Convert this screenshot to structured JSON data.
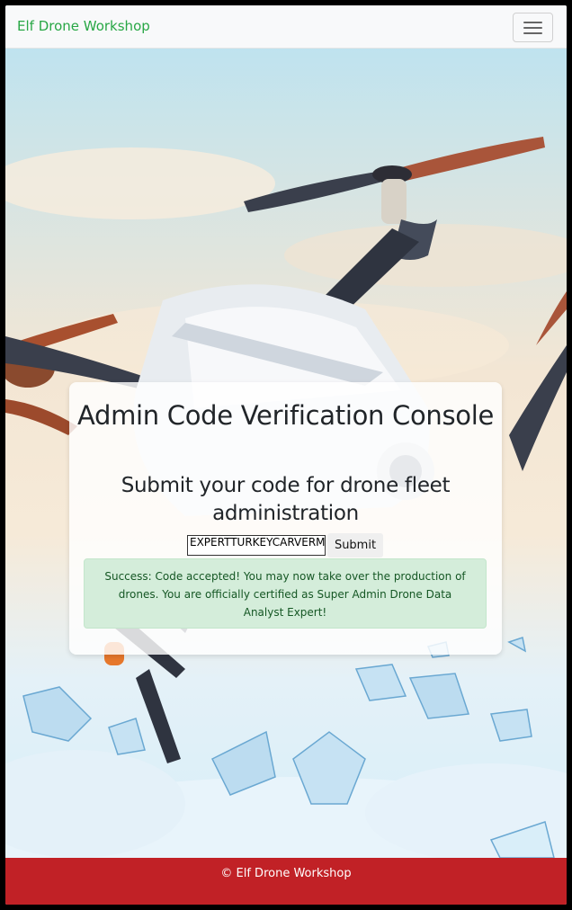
{
  "navbar": {
    "brand": "Elf Drone Workshop",
    "toggle_icon": "hamburger-menu-icon"
  },
  "colors": {
    "brand_green": "#28a745",
    "footer_red": "#c12126",
    "alert_bg": "#d4edda",
    "alert_text": "#155724"
  },
  "main": {
    "title": "Admin Code Verification Console",
    "subtitle": "Submit your code for drone fleet administration",
    "code_input_value": "EXPERTTURKEYCARVERMEDAL",
    "submit_label": "Submit",
    "alert_message": "Success: Code accepted! You may now take over the production of drones. You are officially certified as Super Admin Drone Data Analyst Expert!"
  },
  "footer": {
    "text": "© Elf Drone Workshop"
  }
}
